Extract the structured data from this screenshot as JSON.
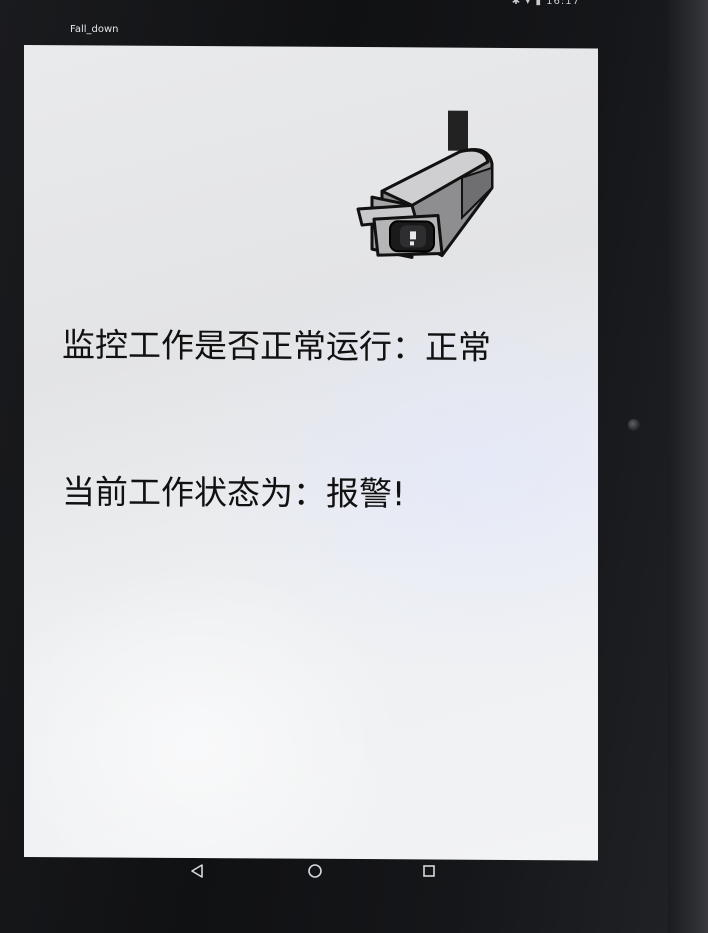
{
  "status_bar": {
    "text": "✱ ▾ ▮ 16:17"
  },
  "app": {
    "title": "Fall_down"
  },
  "monitor": {
    "running_status_line": "监控工作是否正常运行：正常",
    "work_state_line": "当前工作状态为：报警!"
  },
  "icons": {
    "camera": "security-camera-icon",
    "back": "back-triangle-icon",
    "home": "home-circle-icon",
    "recent": "recent-apps-square-icon"
  },
  "colors": {
    "screen_bg": "#e8e9eb",
    "text": "#111111",
    "bezel": "#101113"
  }
}
